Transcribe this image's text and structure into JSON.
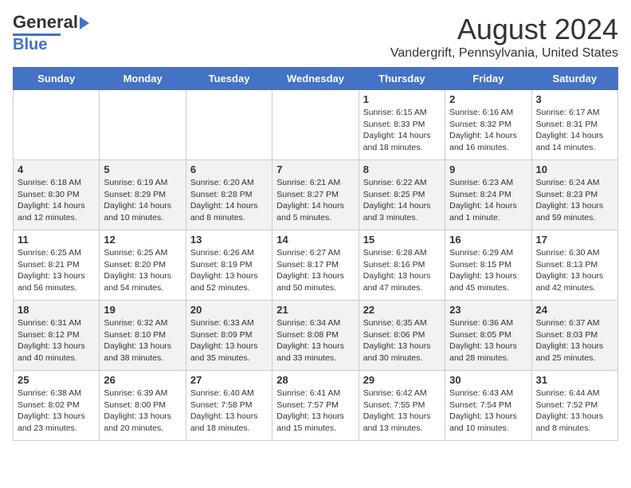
{
  "header": {
    "logo_line1": "General",
    "logo_line2": "Blue",
    "title": "August 2024",
    "subtitle": "Vandergrift, Pennsylvania, United States"
  },
  "calendar": {
    "days_of_week": [
      "Sunday",
      "Monday",
      "Tuesday",
      "Wednesday",
      "Thursday",
      "Friday",
      "Saturday"
    ],
    "weeks": [
      [
        {
          "day": "",
          "info": ""
        },
        {
          "day": "",
          "info": ""
        },
        {
          "day": "",
          "info": ""
        },
        {
          "day": "",
          "info": ""
        },
        {
          "day": "1",
          "info": "Sunrise: 6:15 AM\nSunset: 8:33 PM\nDaylight: 14 hours\nand 18 minutes."
        },
        {
          "day": "2",
          "info": "Sunrise: 6:16 AM\nSunset: 8:32 PM\nDaylight: 14 hours\nand 16 minutes."
        },
        {
          "day": "3",
          "info": "Sunrise: 6:17 AM\nSunset: 8:31 PM\nDaylight: 14 hours\nand 14 minutes."
        }
      ],
      [
        {
          "day": "4",
          "info": "Sunrise: 6:18 AM\nSunset: 8:30 PM\nDaylight: 14 hours\nand 12 minutes."
        },
        {
          "day": "5",
          "info": "Sunrise: 6:19 AM\nSunset: 8:29 PM\nDaylight: 14 hours\nand 10 minutes."
        },
        {
          "day": "6",
          "info": "Sunrise: 6:20 AM\nSunset: 8:28 PM\nDaylight: 14 hours\nand 8 minutes."
        },
        {
          "day": "7",
          "info": "Sunrise: 6:21 AM\nSunset: 8:27 PM\nDaylight: 14 hours\nand 5 minutes."
        },
        {
          "day": "8",
          "info": "Sunrise: 6:22 AM\nSunset: 8:25 PM\nDaylight: 14 hours\nand 3 minutes."
        },
        {
          "day": "9",
          "info": "Sunrise: 6:23 AM\nSunset: 8:24 PM\nDaylight: 14 hours\nand 1 minute."
        },
        {
          "day": "10",
          "info": "Sunrise: 6:24 AM\nSunset: 8:23 PM\nDaylight: 13 hours\nand 59 minutes."
        }
      ],
      [
        {
          "day": "11",
          "info": "Sunrise: 6:25 AM\nSunset: 8:21 PM\nDaylight: 13 hours\nand 56 minutes."
        },
        {
          "day": "12",
          "info": "Sunrise: 6:25 AM\nSunset: 8:20 PM\nDaylight: 13 hours\nand 54 minutes."
        },
        {
          "day": "13",
          "info": "Sunrise: 6:26 AM\nSunset: 8:19 PM\nDaylight: 13 hours\nand 52 minutes."
        },
        {
          "day": "14",
          "info": "Sunrise: 6:27 AM\nSunset: 8:17 PM\nDaylight: 13 hours\nand 50 minutes."
        },
        {
          "day": "15",
          "info": "Sunrise: 6:28 AM\nSunset: 8:16 PM\nDaylight: 13 hours\nand 47 minutes."
        },
        {
          "day": "16",
          "info": "Sunrise: 6:29 AM\nSunset: 8:15 PM\nDaylight: 13 hours\nand 45 minutes."
        },
        {
          "day": "17",
          "info": "Sunrise: 6:30 AM\nSunset: 8:13 PM\nDaylight: 13 hours\nand 42 minutes."
        }
      ],
      [
        {
          "day": "18",
          "info": "Sunrise: 6:31 AM\nSunset: 8:12 PM\nDaylight: 13 hours\nand 40 minutes."
        },
        {
          "day": "19",
          "info": "Sunrise: 6:32 AM\nSunset: 8:10 PM\nDaylight: 13 hours\nand 38 minutes."
        },
        {
          "day": "20",
          "info": "Sunrise: 6:33 AM\nSunset: 8:09 PM\nDaylight: 13 hours\nand 35 minutes."
        },
        {
          "day": "21",
          "info": "Sunrise: 6:34 AM\nSunset: 8:08 PM\nDaylight: 13 hours\nand 33 minutes."
        },
        {
          "day": "22",
          "info": "Sunrise: 6:35 AM\nSunset: 8:06 PM\nDaylight: 13 hours\nand 30 minutes."
        },
        {
          "day": "23",
          "info": "Sunrise: 6:36 AM\nSunset: 8:05 PM\nDaylight: 13 hours\nand 28 minutes."
        },
        {
          "day": "24",
          "info": "Sunrise: 6:37 AM\nSunset: 8:03 PM\nDaylight: 13 hours\nand 25 minutes."
        }
      ],
      [
        {
          "day": "25",
          "info": "Sunrise: 6:38 AM\nSunset: 8:02 PM\nDaylight: 13 hours\nand 23 minutes."
        },
        {
          "day": "26",
          "info": "Sunrise: 6:39 AM\nSunset: 8:00 PM\nDaylight: 13 hours\nand 20 minutes."
        },
        {
          "day": "27",
          "info": "Sunrise: 6:40 AM\nSunset: 7:58 PM\nDaylight: 13 hours\nand 18 minutes."
        },
        {
          "day": "28",
          "info": "Sunrise: 6:41 AM\nSunset: 7:57 PM\nDaylight: 13 hours\nand 15 minutes."
        },
        {
          "day": "29",
          "info": "Sunrise: 6:42 AM\nSunset: 7:55 PM\nDaylight: 13 hours\nand 13 minutes."
        },
        {
          "day": "30",
          "info": "Sunrise: 6:43 AM\nSunset: 7:54 PM\nDaylight: 13 hours\nand 10 minutes."
        },
        {
          "day": "31",
          "info": "Sunrise: 6:44 AM\nSunset: 7:52 PM\nDaylight: 13 hours\nand 8 minutes."
        }
      ]
    ]
  }
}
